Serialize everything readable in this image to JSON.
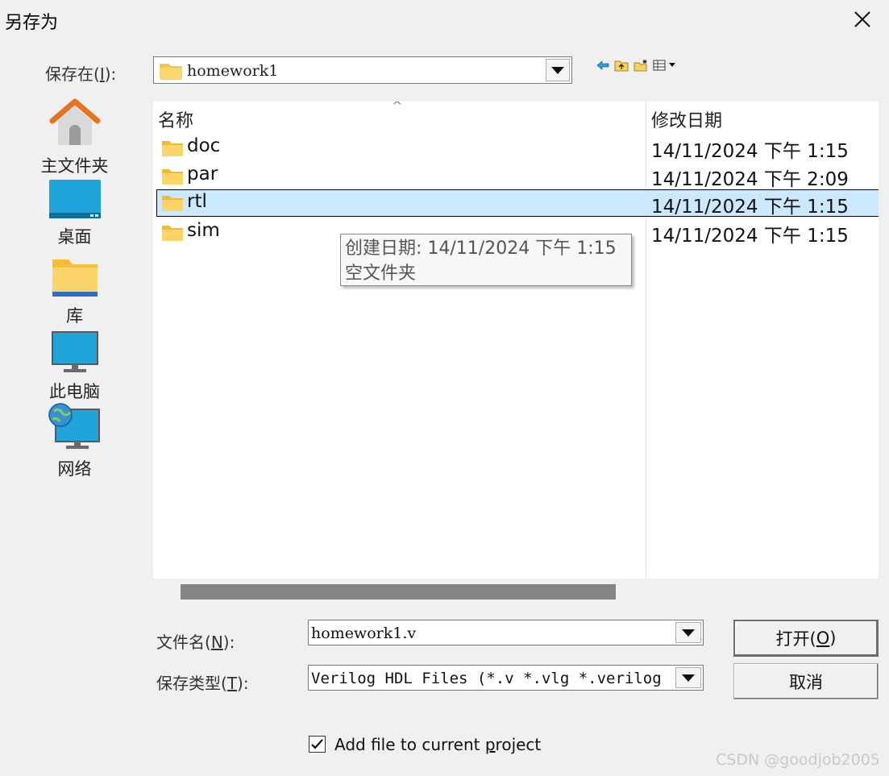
{
  "dialog": {
    "title": "另存为"
  },
  "lookin": {
    "label_prefix": "保存在(",
    "accel": "I",
    "label_suffix": "):",
    "value": "homework1"
  },
  "places": [
    {
      "label": "主文件夹",
      "icon": "home-icon"
    },
    {
      "label": "桌面",
      "icon": "desktop-icon"
    },
    {
      "label": "库",
      "icon": "library-folder-icon"
    },
    {
      "label": "此电脑",
      "icon": "computer-icon"
    },
    {
      "label": "网络",
      "icon": "network-icon"
    }
  ],
  "list": {
    "col_name": "名称",
    "col_date": "修改日期",
    "sort_indicator": "^",
    "rows": [
      {
        "name": "doc",
        "date": "14/11/2024 下午 1:15",
        "selected": false
      },
      {
        "name": "par",
        "date": "14/11/2024 下午 2:09",
        "selected": false
      },
      {
        "name": "rtl",
        "date": "14/11/2024 下午 1:15",
        "selected": true
      },
      {
        "name": "sim",
        "date": "14/11/2024 下午 1:15",
        "selected": false
      }
    ]
  },
  "tooltip": {
    "line1": "创建日期: 14/11/2024 下午 1:15",
    "line2": "空文件夹"
  },
  "filename": {
    "label_prefix": "文件名(",
    "accel": "N",
    "label_suffix": "):",
    "value": "homework1.v"
  },
  "filetype": {
    "label_prefix": "保存类型(",
    "accel": "T",
    "label_suffix": "):",
    "value": "Verilog HDL Files (*.v *.vlg *.verilog"
  },
  "buttons": {
    "open_prefix": "打开(",
    "open_accel": "O",
    "open_suffix": ")",
    "cancel": "取消"
  },
  "add_to_project": {
    "label_pre": "Add file to current ",
    "accel": "p",
    "label_post": "roject",
    "checked": true
  },
  "watermark": "CSDN @goodjob2005",
  "colors": {
    "selection": "#cce8ff",
    "folder": "#f8c94a",
    "scroll_thumb": "#858585"
  }
}
